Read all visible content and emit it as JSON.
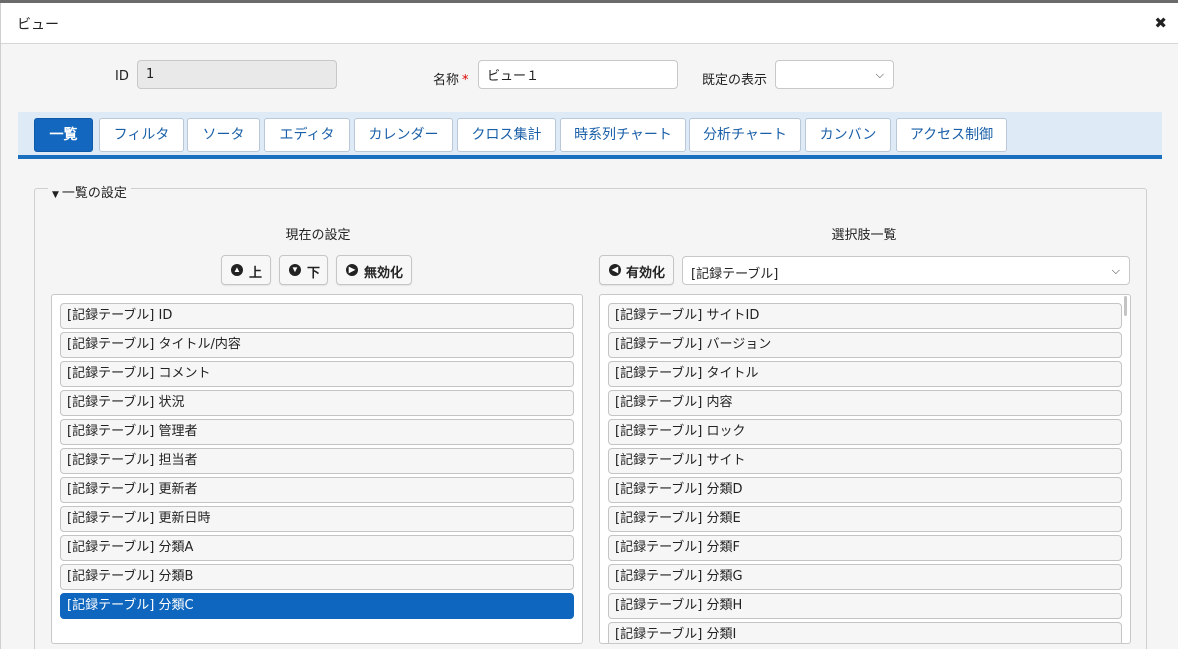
{
  "dialog": {
    "title": "ビュー",
    "close_icon": "✖"
  },
  "form": {
    "id_label": "ID",
    "id_value": "1",
    "name_label": "名称",
    "required_mark": "*",
    "name_value": "ビュー１",
    "default_display_label": "既定の表示",
    "default_display_value": ""
  },
  "tabs": [
    {
      "label": "一覧",
      "active": true
    },
    {
      "label": "フィルタ"
    },
    {
      "label": "ソータ"
    },
    {
      "label": "エディタ"
    },
    {
      "label": "カレンダー"
    },
    {
      "label": "クロス集計"
    },
    {
      "label": "時系列チャート"
    },
    {
      "label": "分析チャート"
    },
    {
      "label": "カンバン"
    },
    {
      "label": "アクセス制御"
    }
  ],
  "section": {
    "title": "一覧の設定"
  },
  "current": {
    "header": "現在の設定",
    "btn_up": "上",
    "btn_down": "下",
    "btn_disable": "無効化",
    "items": [
      "[記録テーブル] ID",
      "[記録テーブル] タイトル/内容",
      "[記録テーブル] コメント",
      "[記録テーブル] 状況",
      "[記録テーブル] 管理者",
      "[記録テーブル] 担当者",
      "[記録テーブル] 更新者",
      "[記録テーブル] 更新日時",
      "[記録テーブル] 分類A",
      "[記録テーブル] 分類B",
      "[記録テーブル] 分類C"
    ],
    "selected_index": 10
  },
  "choices": {
    "header": "選択肢一覧",
    "btn_enable": "有効化",
    "source_select": "[記録テーブル]",
    "items": [
      "[記録テーブル] サイトID",
      "[記録テーブル] バージョン",
      "[記録テーブル] タイトル",
      "[記録テーブル] 内容",
      "[記録テーブル] ロック",
      "[記録テーブル] サイト",
      "[記録テーブル] 分類D",
      "[記録テーブル] 分類E",
      "[記録テーブル] 分類F",
      "[記録テーブル] 分類G",
      "[記録テーブル] 分類H",
      "[記録テーブル] 分類I"
    ]
  },
  "icons": {
    "up": "chevron-up-circle-icon",
    "down": "chevron-down-circle-icon",
    "disable": "chevron-right-circle-icon",
    "enable": "chevron-left-circle-icon",
    "section": "caret-down-icon",
    "select": "chevron-down-icon"
  },
  "colors": {
    "accent": "#1467bf",
    "selected": "#0f66be",
    "tab_strip": "#dfeaf7"
  }
}
